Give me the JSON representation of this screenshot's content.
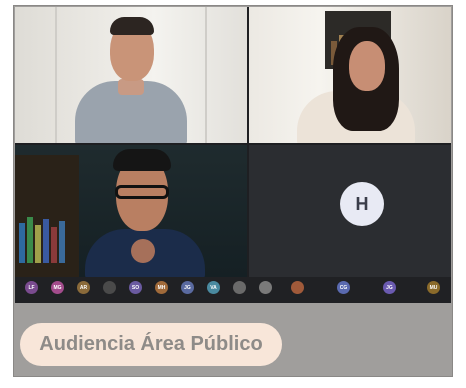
{
  "meeting": {
    "tiles": [
      {
        "kind": "video",
        "description_name": "participant-video-1"
      },
      {
        "kind": "video",
        "description_name": "participant-video-2"
      },
      {
        "kind": "video",
        "description_name": "participant-video-3"
      },
      {
        "kind": "avatar",
        "initial": "H",
        "name": ""
      }
    ],
    "participants": [
      {
        "initials": "LF",
        "color": "#7a4b8f"
      },
      {
        "initials": "MG",
        "color": "#a34c8c"
      },
      {
        "initials": "AR",
        "color": "#8a6a3a"
      },
      {
        "initials": "",
        "color": "#4a4a4a"
      },
      {
        "initials": "SO",
        "color": "#6a5aa0"
      },
      {
        "initials": "MH",
        "color": "#a06a3a"
      },
      {
        "initials": "JG",
        "color": "#5a6aa0"
      },
      {
        "initials": "VA",
        "color": "#4a8aa0"
      },
      {
        "initials": "",
        "color": "#6a6a6a"
      },
      {
        "initials": "",
        "color": "#7a7a7a"
      },
      {
        "initials": "",
        "color": "#a05a3a"
      },
      {
        "initials": "CG",
        "color": "#5a6ab0"
      },
      {
        "initials": "JG",
        "color": "#6a5ab0"
      },
      {
        "initials": "MU",
        "color": "#8a6a2a"
      }
    ]
  },
  "caption": {
    "text": "Audiencia Área Público",
    "background": "#f8e6d9",
    "text_color": "#8e8b88"
  }
}
